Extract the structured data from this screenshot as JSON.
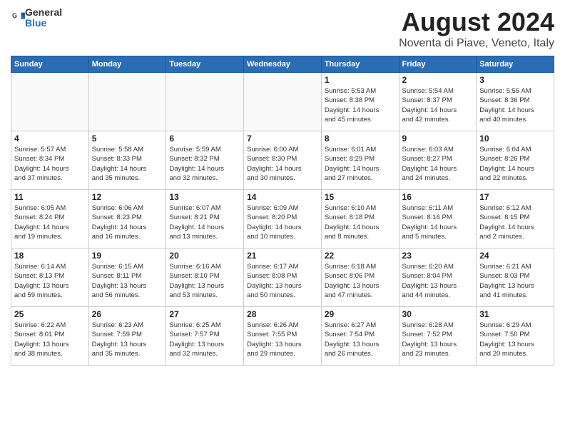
{
  "header": {
    "logo_general": "General",
    "logo_blue": "Blue",
    "month_title": "August 2024",
    "location": "Noventa di Piave, Veneto, Italy"
  },
  "weekdays": [
    "Sunday",
    "Monday",
    "Tuesday",
    "Wednesday",
    "Thursday",
    "Friday",
    "Saturday"
  ],
  "weeks": [
    [
      {
        "day": "",
        "info": ""
      },
      {
        "day": "",
        "info": ""
      },
      {
        "day": "",
        "info": ""
      },
      {
        "day": "",
        "info": ""
      },
      {
        "day": "1",
        "info": "Sunrise: 5:53 AM\nSunset: 8:38 PM\nDaylight: 14 hours\nand 45 minutes."
      },
      {
        "day": "2",
        "info": "Sunrise: 5:54 AM\nSunset: 8:37 PM\nDaylight: 14 hours\nand 42 minutes."
      },
      {
        "day": "3",
        "info": "Sunrise: 5:55 AM\nSunset: 8:36 PM\nDaylight: 14 hours\nand 40 minutes."
      }
    ],
    [
      {
        "day": "4",
        "info": "Sunrise: 5:57 AM\nSunset: 8:34 PM\nDaylight: 14 hours\nand 37 minutes."
      },
      {
        "day": "5",
        "info": "Sunrise: 5:58 AM\nSunset: 8:33 PM\nDaylight: 14 hours\nand 35 minutes."
      },
      {
        "day": "6",
        "info": "Sunrise: 5:59 AM\nSunset: 8:32 PM\nDaylight: 14 hours\nand 32 minutes."
      },
      {
        "day": "7",
        "info": "Sunrise: 6:00 AM\nSunset: 8:30 PM\nDaylight: 14 hours\nand 30 minutes."
      },
      {
        "day": "8",
        "info": "Sunrise: 6:01 AM\nSunset: 8:29 PM\nDaylight: 14 hours\nand 27 minutes."
      },
      {
        "day": "9",
        "info": "Sunrise: 6:03 AM\nSunset: 8:27 PM\nDaylight: 14 hours\nand 24 minutes."
      },
      {
        "day": "10",
        "info": "Sunrise: 6:04 AM\nSunset: 8:26 PM\nDaylight: 14 hours\nand 22 minutes."
      }
    ],
    [
      {
        "day": "11",
        "info": "Sunrise: 6:05 AM\nSunset: 8:24 PM\nDaylight: 14 hours\nand 19 minutes."
      },
      {
        "day": "12",
        "info": "Sunrise: 6:06 AM\nSunset: 8:23 PM\nDaylight: 14 hours\nand 16 minutes."
      },
      {
        "day": "13",
        "info": "Sunrise: 6:07 AM\nSunset: 8:21 PM\nDaylight: 14 hours\nand 13 minutes."
      },
      {
        "day": "14",
        "info": "Sunrise: 6:09 AM\nSunset: 8:20 PM\nDaylight: 14 hours\nand 10 minutes."
      },
      {
        "day": "15",
        "info": "Sunrise: 6:10 AM\nSunset: 8:18 PM\nDaylight: 14 hours\nand 8 minutes."
      },
      {
        "day": "16",
        "info": "Sunrise: 6:11 AM\nSunset: 8:16 PM\nDaylight: 14 hours\nand 5 minutes."
      },
      {
        "day": "17",
        "info": "Sunrise: 6:12 AM\nSunset: 8:15 PM\nDaylight: 14 hours\nand 2 minutes."
      }
    ],
    [
      {
        "day": "18",
        "info": "Sunrise: 6:14 AM\nSunset: 8:13 PM\nDaylight: 13 hours\nand 59 minutes."
      },
      {
        "day": "19",
        "info": "Sunrise: 6:15 AM\nSunset: 8:11 PM\nDaylight: 13 hours\nand 56 minutes."
      },
      {
        "day": "20",
        "info": "Sunrise: 6:16 AM\nSunset: 8:10 PM\nDaylight: 13 hours\nand 53 minutes."
      },
      {
        "day": "21",
        "info": "Sunrise: 6:17 AM\nSunset: 8:08 PM\nDaylight: 13 hours\nand 50 minutes."
      },
      {
        "day": "22",
        "info": "Sunrise: 6:18 AM\nSunset: 8:06 PM\nDaylight: 13 hours\nand 47 minutes."
      },
      {
        "day": "23",
        "info": "Sunrise: 6:20 AM\nSunset: 8:04 PM\nDaylight: 13 hours\nand 44 minutes."
      },
      {
        "day": "24",
        "info": "Sunrise: 6:21 AM\nSunset: 8:03 PM\nDaylight: 13 hours\nand 41 minutes."
      }
    ],
    [
      {
        "day": "25",
        "info": "Sunrise: 6:22 AM\nSunset: 8:01 PM\nDaylight: 13 hours\nand 38 minutes."
      },
      {
        "day": "26",
        "info": "Sunrise: 6:23 AM\nSunset: 7:59 PM\nDaylight: 13 hours\nand 35 minutes."
      },
      {
        "day": "27",
        "info": "Sunrise: 6:25 AM\nSunset: 7:57 PM\nDaylight: 13 hours\nand 32 minutes."
      },
      {
        "day": "28",
        "info": "Sunrise: 6:26 AM\nSunset: 7:55 PM\nDaylight: 13 hours\nand 29 minutes."
      },
      {
        "day": "29",
        "info": "Sunrise: 6:27 AM\nSunset: 7:54 PM\nDaylight: 13 hours\nand 26 minutes."
      },
      {
        "day": "30",
        "info": "Sunrise: 6:28 AM\nSunset: 7:52 PM\nDaylight: 13 hours\nand 23 minutes."
      },
      {
        "day": "31",
        "info": "Sunrise: 6:29 AM\nSunset: 7:50 PM\nDaylight: 13 hours\nand 20 minutes."
      }
    ]
  ]
}
